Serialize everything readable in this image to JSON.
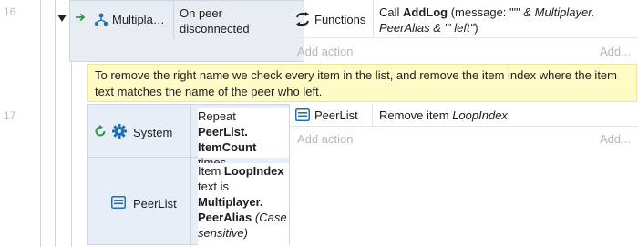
{
  "events": {
    "e16": {
      "line_number": "16",
      "object": "Multipla…",
      "condition": {
        "line1": "On peer",
        "line2": "disconnected"
      },
      "action": {
        "object": "Functions",
        "text_pre": "Call ",
        "text_bold": "AddLog",
        "text_mid": " (message: \"'\" ",
        "text_ital1": "& Multiplayer.",
        "text_ital2": "PeerAlias & \"' left\"",
        "text_end": ")"
      },
      "add_action": "Add action",
      "add_short": "Add..."
    },
    "comment": "To remove the right name we check every item in the list, and remove the item index where the item text matches the name of the peer who left.",
    "e17": {
      "line_number": "17",
      "cond1": {
        "object": "System",
        "l1_pre": "Repeat ",
        "l1_bold": "PeerList.",
        "l2_bold": "ItemCount",
        "l3": "times"
      },
      "cond2": {
        "object": "PeerList",
        "l1_pre": "Item ",
        "l1_bold": "LoopIndex",
        "l2": "text is",
        "l3_bold": "Multiplayer.",
        "l4_bold": "PeerAlias",
        "l4_ital": " (Case",
        "l5_ital": "sensitive)"
      },
      "action": {
        "object": "PeerList",
        "text_pre": "Remove item ",
        "text_ital": "LoopIndex"
      },
      "add_action": "Add action",
      "add_short": "Add..."
    }
  },
  "colors": {
    "accent_green": "#2e9a3e",
    "accent_blue": "#1f6fb5",
    "selected_bg": "#e8edf4",
    "comment_bg": "#fffbc5"
  }
}
